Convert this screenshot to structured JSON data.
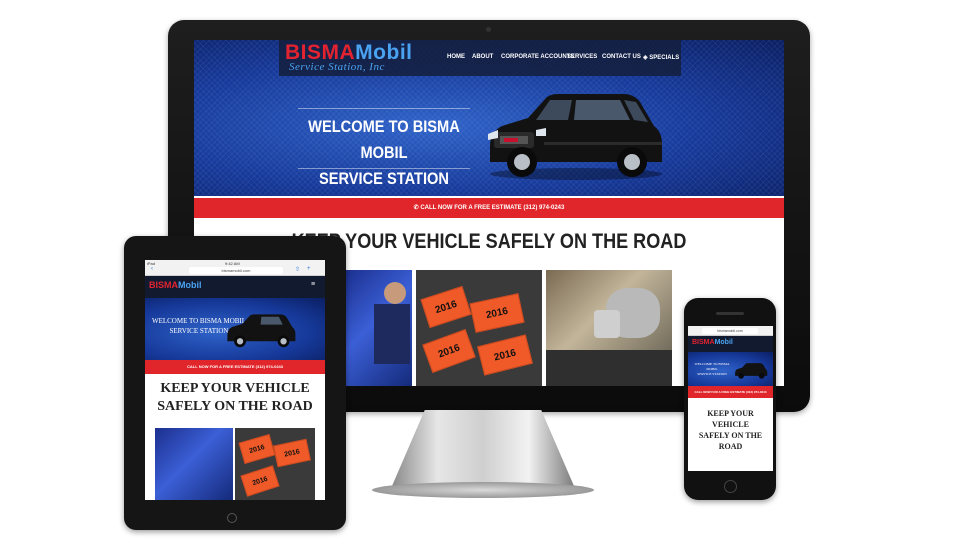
{
  "site": {
    "logo_primary": "BISMA",
    "logo_secondary": "Mobil",
    "logo_sub": "Service Station, Inc",
    "nav": [
      {
        "label": "HOME"
      },
      {
        "label": "ABOUT"
      },
      {
        "label": "CORPORATE ACCOUNTS"
      },
      {
        "label": "SERVICES"
      },
      {
        "label": "CONTACT US"
      },
      {
        "label": "SPECIALS"
      }
    ],
    "hero_title_line1": "WELCOME TO BISMA MOBIL",
    "hero_title_line2": "SERVICE STATION",
    "call_bar": "CALL NOW FOR A FREE ESTIMATE (312) 974-0243",
    "section_title": "KEEP YOUR VEHICLE SAFELY ON THE ROAD",
    "sticker_year": "2016"
  },
  "tablet": {
    "status_time": "9:42 AM",
    "status_left": "iPad",
    "url": "bismamobil.com",
    "hero_title_line1": "WELCOME TO BISMA MOBIL",
    "hero_title_line2": "SERVICE STATION",
    "section_line1": "KEEP YOUR VEHICLE",
    "section_line2": "SAFELY ON THE ROAD"
  },
  "phone": {
    "url": "bismamobil.com",
    "hero_title_line1": "WELCOME TO BISMA MOBIL",
    "hero_title_line2": "SERVICE STATION",
    "section_line1": "KEEP YOUR",
    "section_line2": "VEHICLE",
    "section_line3": "SAFELY ON THE",
    "section_line4": "ROAD"
  },
  "colors": {
    "brand_red": "#e0262b",
    "brand_blue": "#16399a",
    "logo_blue": "#4aa3f0"
  }
}
